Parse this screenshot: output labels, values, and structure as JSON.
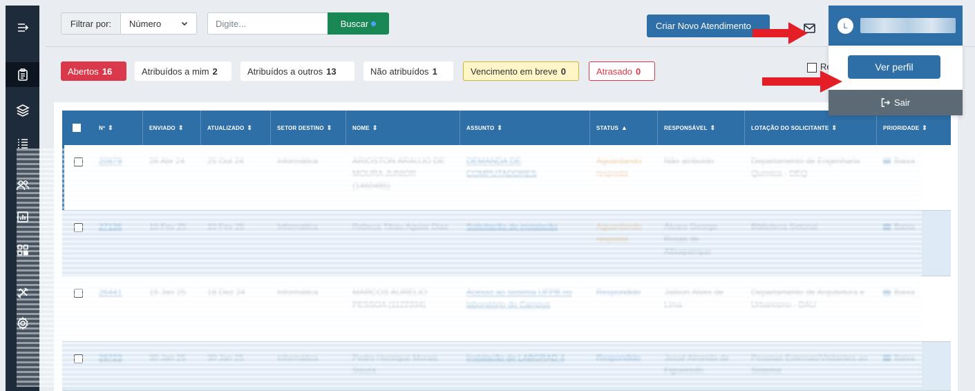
{
  "sidebar": {
    "items": [
      {
        "icon": "menu-expand-icon"
      },
      {
        "icon": "clipboard-icon",
        "active": true
      },
      {
        "icon": "layers-icon"
      },
      {
        "icon": "list-icon"
      },
      {
        "icon": "users-icon"
      },
      {
        "icon": "chart-icon"
      },
      {
        "icon": "apps-grid-icon"
      },
      {
        "icon": "tools-icon"
      },
      {
        "icon": "gear-icon"
      }
    ]
  },
  "topbar": {
    "filter_label": "Filtrar por:",
    "filter_value": "Número",
    "search_placeholder": "Digite...",
    "search_button": "Buscar",
    "create_button": "Criar Novo Atendimento",
    "user_initial": "L",
    "user_name": "",
    "profile_button": "Ver perfil",
    "logout_label": "Sair"
  },
  "badges": [
    {
      "label": "Abertos",
      "count": "16",
      "style": "red"
    },
    {
      "label": "Atribuídos a mim",
      "count": "2",
      "style": "plain"
    },
    {
      "label": "Atribuídos a outros",
      "count": "13",
      "style": "plain"
    },
    {
      "label": "Não atribuídos",
      "count": "1",
      "style": "plain"
    },
    {
      "label": "Vencimento em breve",
      "count": "0",
      "style": "yellow"
    },
    {
      "label": "Atrasado",
      "count": "0",
      "style": "redline"
    }
  ],
  "recent_label": "Re",
  "table": {
    "columns": [
      "Nº",
      "ENVIADO",
      "ATUALIZADO",
      "SETOR DESTINO",
      "NOME",
      "ASSUNTO",
      "STATUS",
      "RESPONSÁVEL",
      "LOTAÇÃO DO SOLICITANTE",
      "PRIORIDADE"
    ],
    "sort_icons": [
      "⇕",
      "⇕",
      "⇕",
      "⇕",
      "⇕",
      "⇕",
      "▲",
      "⇕",
      "⇕",
      "⇕"
    ],
    "rows": [
      {
        "num": "20879",
        "sent": "26 Abr 24",
        "updated": "25 Out 24",
        "sector": "Informática",
        "name": "ARIOSTON ARAUJO DE MOURA JUNIOR (1460485)",
        "subject": "DEMANDA DE COMPUTADORES",
        "status": "Aguardando resposta",
        "responsible": "Não atribuído",
        "location": "Departamento de Engenharia Química - DEQ",
        "priority": "Baixa"
      },
      {
        "num": "27136",
        "sent": "10 Fev 25",
        "updated": "10 Fev 25",
        "sector": "Informática",
        "name": "Rebeca Tibau Aguiar Dias",
        "subject": "Solicitação de instalação",
        "status": "Aguardando resposta",
        "responsible": "Álvaro George Rosas de Albuquerque",
        "location": "Biblioteca Setorial",
        "priority": "Baixa"
      },
      {
        "num": "26441",
        "sent": "15 Jan 25",
        "updated": "18 Dez 24",
        "sector": "Informática",
        "name": "MARCOS AURELIO PESSOA (1122334)",
        "subject": "Acesso ao sistema UFPB no laboratório do Campus",
        "status": "Respondido",
        "responsible": "Jailson Alves de Lima",
        "location": "Departamento de Arquitetura e Urbanismo - DAU",
        "priority": "Baixa"
      },
      {
        "num": "26723",
        "sent": "30 Jan 25",
        "updated": "30 Jan 25",
        "sector": "Informática",
        "name": "Pedro Henrique Morais Souza",
        "subject": "Instalação de LABGRAD 4",
        "status": "Respondido",
        "responsible": "Jessé Almeida de Figueiredo",
        "location": "Pessoas Externas/Visitantes ao Sistema",
        "priority": "Baixa"
      }
    ]
  }
}
